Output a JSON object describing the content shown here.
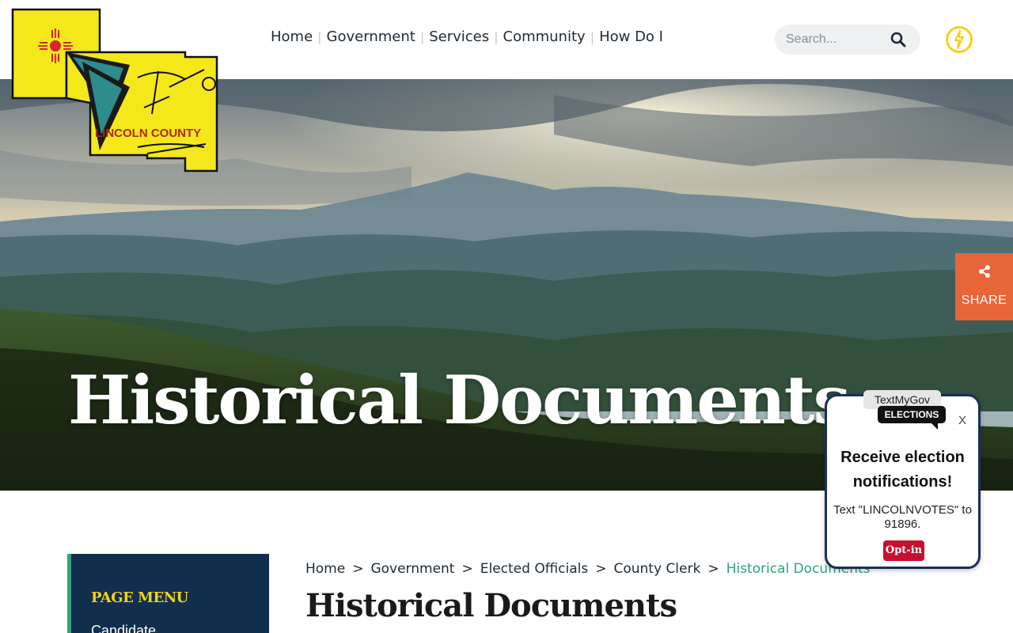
{
  "logo": {
    "text": "LINCOLN COUNTY",
    "colors": {
      "state": "#f5e81a",
      "outline": "#111111",
      "teal": "#2e8c8c",
      "zia": "#d6282b"
    }
  },
  "nav": {
    "items": [
      {
        "label": "Home"
      },
      {
        "label": "Government"
      },
      {
        "label": "Services"
      },
      {
        "label": "Community"
      },
      {
        "label": "How Do I"
      }
    ]
  },
  "search": {
    "placeholder": "Search...",
    "icon": "search-icon"
  },
  "accessibility": {
    "icon": "power-icon",
    "color": "#f2d21b"
  },
  "hero": {
    "title": "Historical Documents"
  },
  "share": {
    "label": "SHARE",
    "icon": "share-icon",
    "color": "#e8653a"
  },
  "sidebar": {
    "title": "PAGE MENU",
    "items": [
      {
        "label": "Candidate"
      }
    ]
  },
  "breadcrumb": {
    "items": [
      "Home",
      "Government",
      "Elected Officials",
      "County Clerk"
    ],
    "separator": ">",
    "current": "Historical Documents"
  },
  "page": {
    "title": "Historical Documents"
  },
  "popup": {
    "badge_top": "TextMyGov",
    "badge_bottom": "ELECTIONS",
    "close": "X",
    "heading": "Receive election notifications!",
    "text": "Text \"LINCOLNVOTES\" to 91896.",
    "button": "Opt-in"
  }
}
